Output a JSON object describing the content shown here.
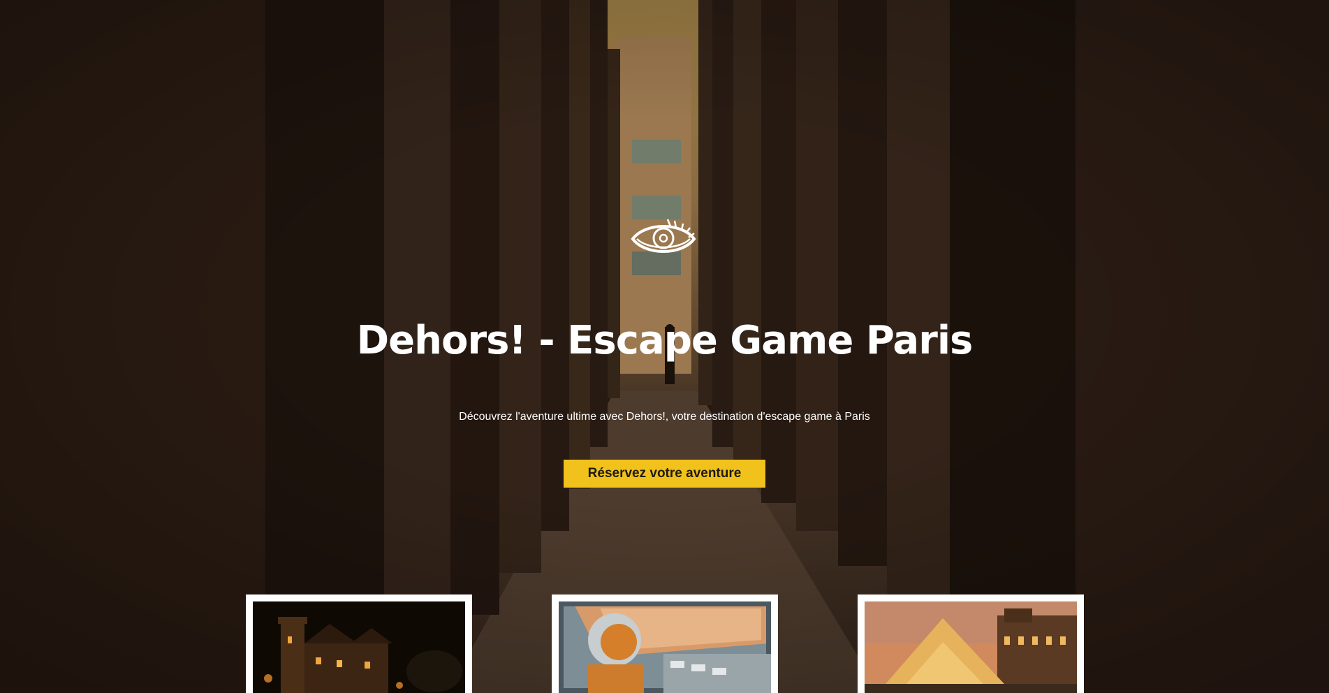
{
  "hero": {
    "logo_icon": "eye-icon",
    "title": "Dehors! - Escape Game Paris",
    "subtitle": "Découvrez l'aventure ultime avec Dehors!, votre destination d'escape game à Paris",
    "cta_label": "Réservez votre aventure"
  },
  "cards": [
    {
      "image": "castle-at-night"
    },
    {
      "image": "astronaut-in-cockpit"
    },
    {
      "image": "louvre-pyramid-at-dusk"
    }
  ],
  "colors": {
    "accent": "#f1c21b",
    "cta_text": "#1e1a14",
    "hero_bg": "#2b1d14",
    "text": "#ffffff"
  }
}
